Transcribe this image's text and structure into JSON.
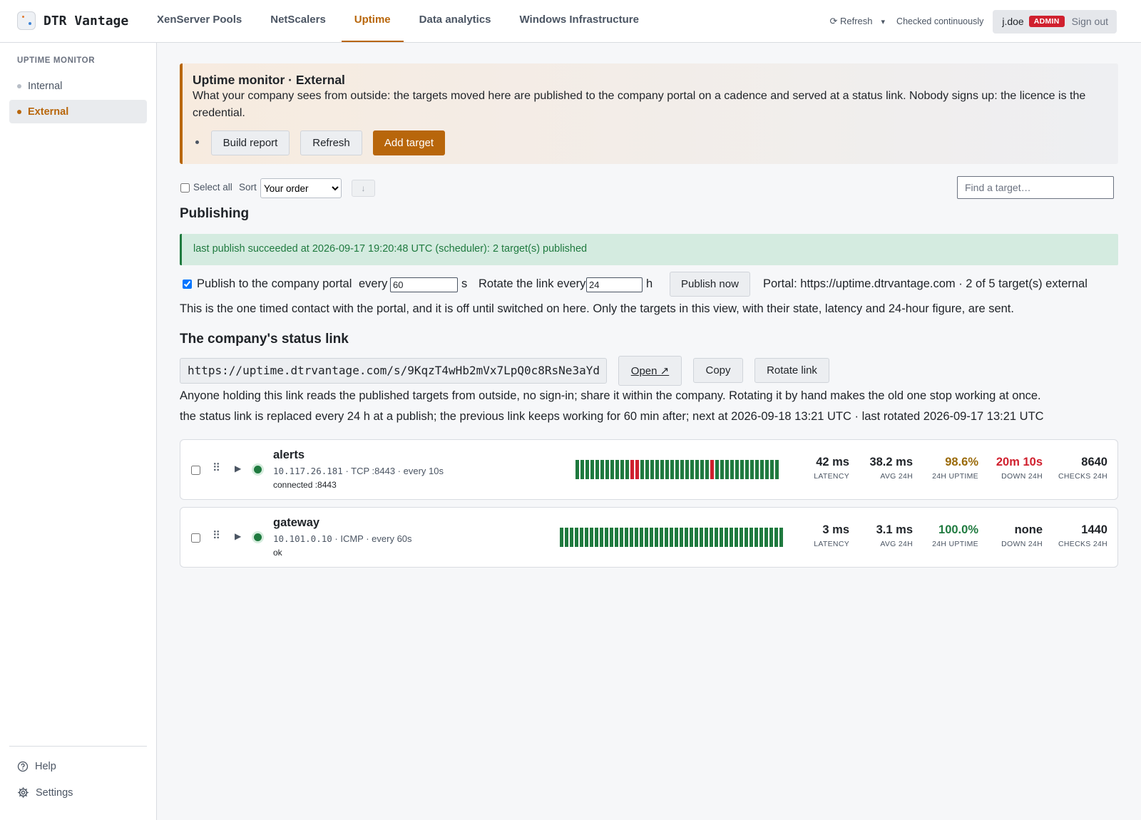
{
  "app": {
    "name": "DTR Vantage"
  },
  "nav": {
    "tabs": [
      {
        "label": "XenServer Pools"
      },
      {
        "label": "NetScalers"
      },
      {
        "label": "Uptime",
        "active": true
      },
      {
        "label": "Data analytics"
      },
      {
        "label": "Windows Infrastructure"
      }
    ]
  },
  "header": {
    "refresh_label": "⟳ Refresh",
    "refresh_menu_glyph": "▾",
    "checked_label": "Checked continuously",
    "user": "j.doe",
    "role": "ADMIN",
    "signout": "Sign out"
  },
  "sidebar": {
    "heading": "UPTIME MONITOR",
    "items": [
      {
        "label": "Internal"
      },
      {
        "label": "External",
        "active": true
      }
    ],
    "footer": {
      "help": "Help",
      "settings": "Settings"
    }
  },
  "banner": {
    "title": "Uptime monitor · External",
    "text": "What your company sees from outside: the targets moved here are published to the company portal on a cadence and served at a status link. Nobody signs up: the licence is the credential.",
    "buttons": {
      "build_report": "Build report",
      "refresh": "Refresh",
      "add_target": "Add target"
    }
  },
  "toolbar": {
    "select_all": "Select all",
    "sort_label": "Sort",
    "sort_value": "Your order",
    "sort_dir": "↓",
    "search_placeholder": "Find a target…"
  },
  "publishing": {
    "heading": "Publishing",
    "last_publish": "last publish succeeded at 2026-09-17 19:20:48 UTC (scheduler): 2 target(s) published",
    "publish_label": "Publish to the company portal",
    "publish_enabled": true,
    "every_label": "every",
    "every_value": "60",
    "every_unit": "s",
    "rotate_label": "Rotate the link every",
    "rotate_value": "24",
    "rotate_unit": "h",
    "publish_now": "Publish now",
    "portal_info": "Portal: https://uptime.dtrvantage.com · 2 of 5 target(s) external",
    "note": "This is the one timed contact with the portal, and it is off until switched on here. Only the targets in this view, with their state, latency and 24-hour figure, are sent."
  },
  "status_link": {
    "heading": "The company's status link",
    "url": "https://uptime.dtrvantage.com/s/9KqzT4wHb2mVx7LpQ0c8RsNe3aYd",
    "open": "Open ↗",
    "copy": "Copy",
    "rotate": "Rotate link",
    "note1": "Anyone holding this link reads the published targets from outside, no sign-in; share it within the company. Rotating it by hand makes the old one stop working at once.",
    "note2": "the status link is replaced every 24 h at a publish; the previous link keeps working for 60 min after; next at 2026-09-18 13:21 UTC · last rotated 2026-09-17 13:21 UTC"
  },
  "status_colors": {
    "up": "#1f7a3f",
    "down": "#d0202e",
    "accent": "#b8660b"
  },
  "stat_labels": {
    "latency": "LATENCY",
    "avg": "AVG 24H",
    "uptime": "24H UPTIME",
    "down": "DOWN 24H",
    "checks": "CHECKS 24H"
  },
  "targets": [
    {
      "name": "alerts",
      "address": "10.117.26.181",
      "probe": " · TCP :8443 · every 10s",
      "status": "connected :8443",
      "state": "up",
      "history": [
        1,
        1,
        1,
        1,
        1,
        1,
        1,
        1,
        1,
        1,
        1,
        0,
        0,
        1,
        1,
        1,
        1,
        1,
        1,
        1,
        1,
        1,
        1,
        1,
        1,
        1,
        1,
        0,
        1,
        1,
        1,
        1,
        1,
        1,
        1,
        1,
        1,
        1,
        1,
        1,
        1
      ],
      "latency": "42 ms",
      "avg": "38.2 ms",
      "uptime": "98.6%",
      "down": "20m 10s",
      "checks": "8640"
    },
    {
      "name": "gateway",
      "address": "10.101.0.10",
      "probe": " · ICMP · every 60s",
      "status": "ok",
      "state": "up",
      "history": [
        1,
        1,
        1,
        1,
        1,
        1,
        1,
        1,
        1,
        1,
        1,
        1,
        1,
        1,
        1,
        1,
        1,
        1,
        1,
        1,
        1,
        1,
        1,
        1,
        1,
        1,
        1,
        1,
        1,
        1,
        1,
        1,
        1,
        1,
        1,
        1,
        1,
        1,
        1,
        1,
        1,
        1,
        1,
        1,
        1
      ],
      "latency": "3 ms",
      "avg": "3.1 ms",
      "uptime": "100.0%",
      "down": "none",
      "checks": "1440"
    }
  ]
}
